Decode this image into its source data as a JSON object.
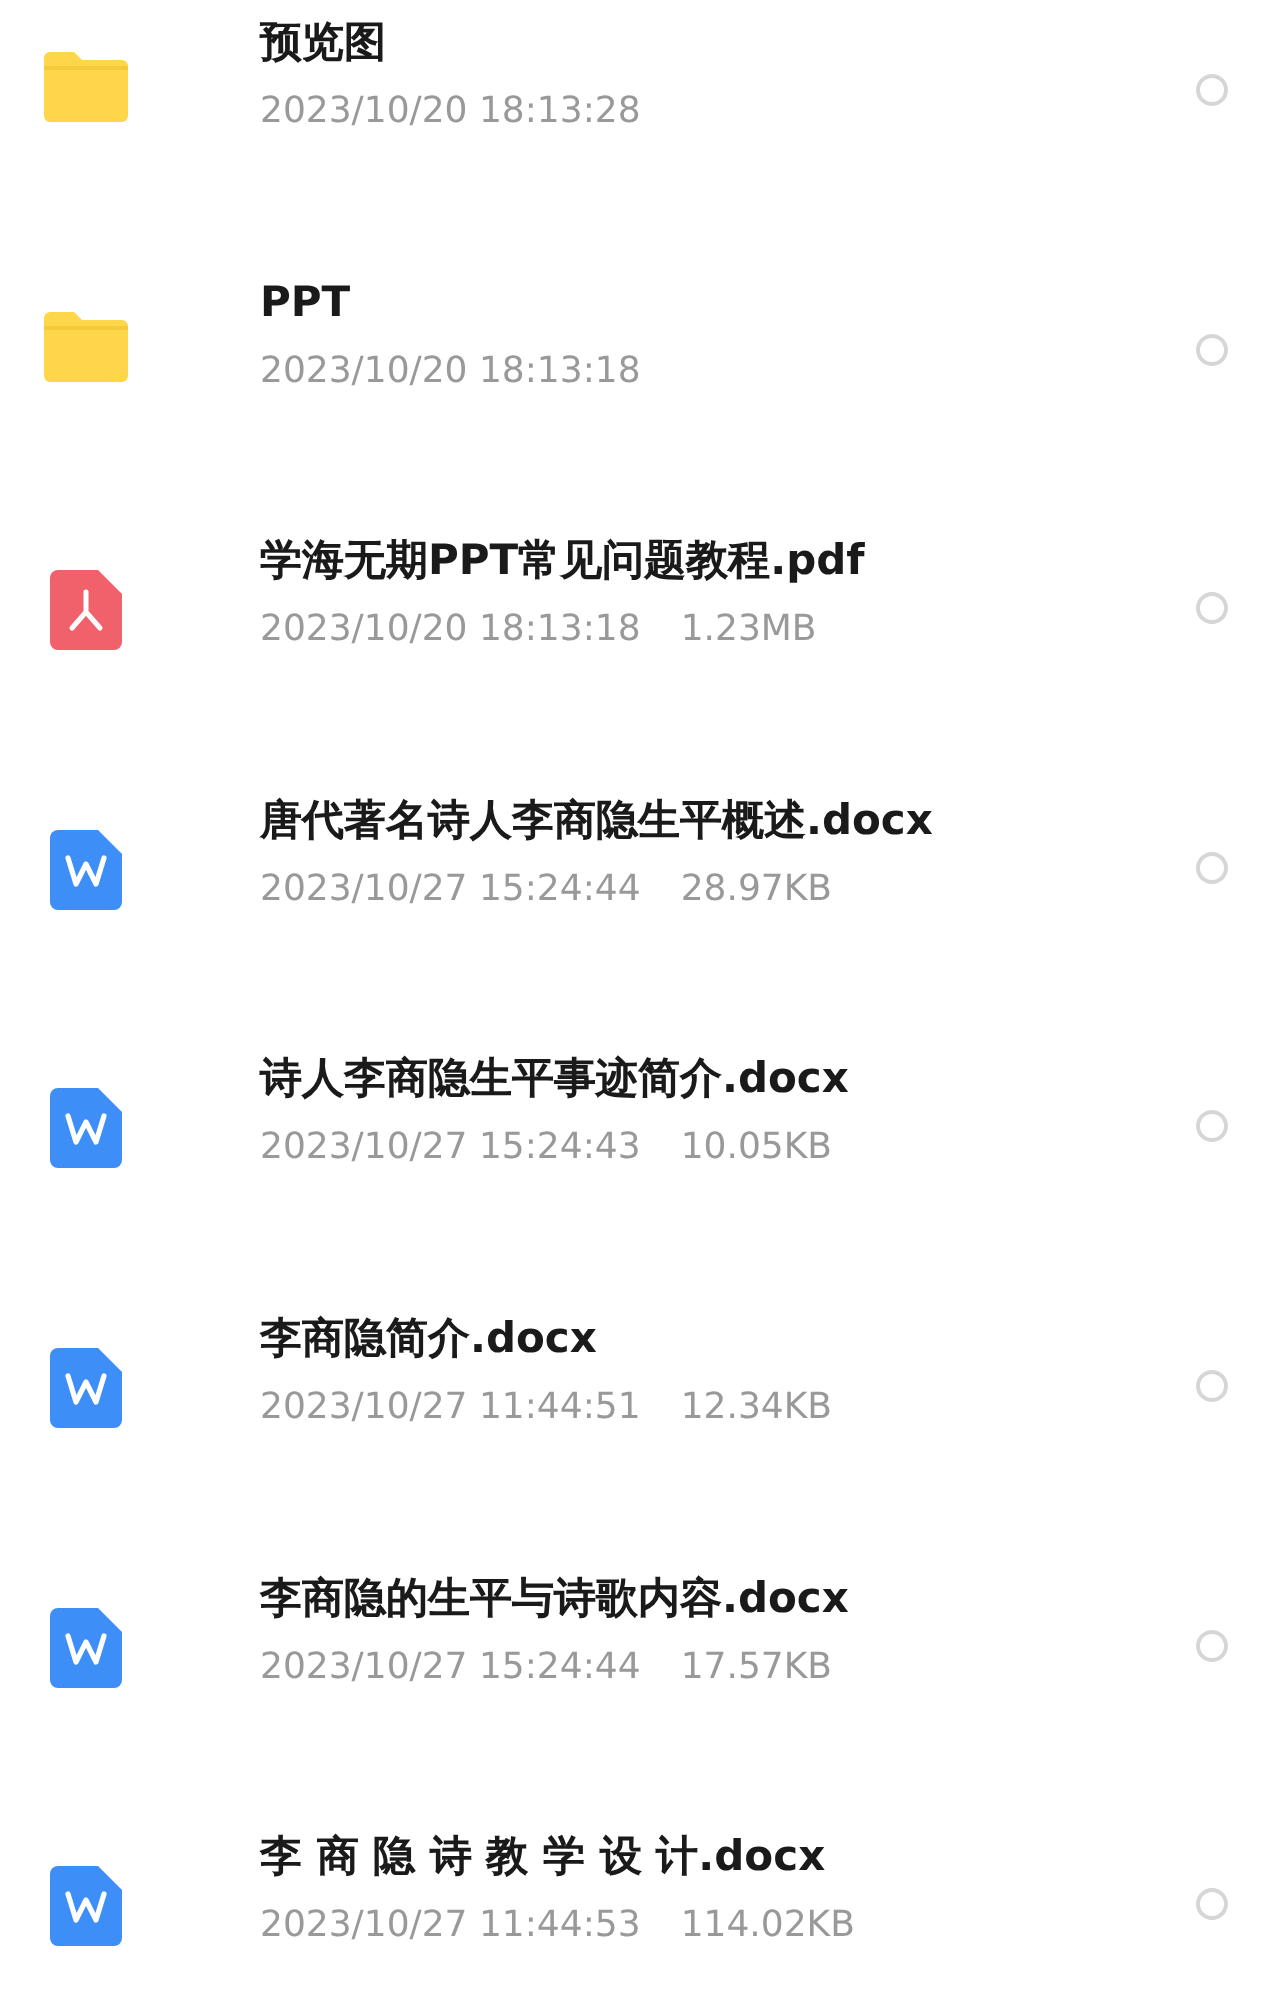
{
  "files": [
    {
      "kind": "folder",
      "name": "预览图",
      "date": "2023/10/20 18:13:28",
      "selected": false
    },
    {
      "kind": "folder",
      "name": "PPT",
      "date": "2023/10/20 18:13:18",
      "selected": false
    },
    {
      "kind": "pdf",
      "name": "学海无期PPT常见问题教程.pdf",
      "date": "2023/10/20 18:13:18",
      "size": "1.23MB",
      "selected": false
    },
    {
      "kind": "word",
      "name": "唐代著名诗人李商隐生平概述.docx",
      "date": "2023/10/27 15:24:44",
      "size": "28.97KB",
      "selected": false
    },
    {
      "kind": "word",
      "name": "诗人李商隐生平事迹简介.docx",
      "date": "2023/10/27 15:24:43",
      "size": "10.05KB",
      "selected": false
    },
    {
      "kind": "word",
      "name": "李商隐简介.docx",
      "date": "2023/10/27 11:44:51",
      "size": "12.34KB",
      "selected": false
    },
    {
      "kind": "word",
      "name": "李商隐的生平与诗歌内容.docx",
      "date": "2023/10/27 15:24:44",
      "size": "17.57KB",
      "selected": false
    },
    {
      "kind": "word",
      "name": "李 商 隐 诗 教 学 设 计.docx",
      "date": "2023/10/27 11:44:53",
      "size": "114.02KB",
      "selected": false
    }
  ]
}
